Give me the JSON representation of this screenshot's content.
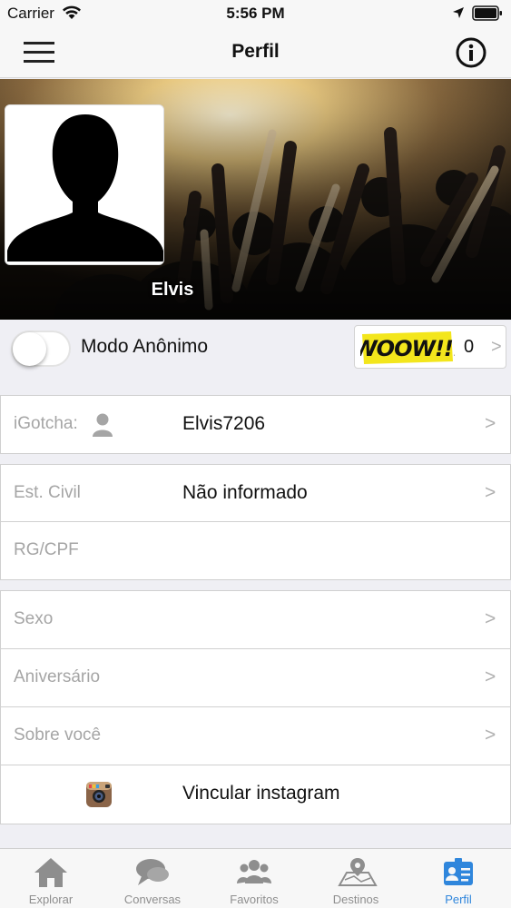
{
  "status_bar": {
    "carrier": "Carrier",
    "time": "5:56 PM"
  },
  "nav": {
    "title": "Perfil"
  },
  "banner": {
    "name": "Elvis"
  },
  "anon": {
    "label": "Modo Anônimo",
    "woow_logo_text": "WOOW!!!",
    "woow_count": "0"
  },
  "rows": {
    "igotcha": {
      "label": "iGotcha:",
      "value": "Elvis7206"
    },
    "civil": {
      "label": "Est. Civil",
      "value": "Não informado"
    },
    "rg": {
      "label": "RG/CPF"
    },
    "sexo": {
      "label": "Sexo"
    },
    "aniversario": {
      "label": "Aniversário"
    },
    "sobre": {
      "label": "Sobre você"
    },
    "instagram": {
      "label": "Vincular instagram"
    }
  },
  "tabs": [
    {
      "label": "Explorar",
      "icon": "home-icon"
    },
    {
      "label": "Conversas",
      "icon": "chat-icon"
    },
    {
      "label": "Favoritos",
      "icon": "group-icon"
    },
    {
      "label": "Destinos",
      "icon": "map-icon"
    },
    {
      "label": "Perfil",
      "icon": "profile-card-icon",
      "active": true
    }
  ],
  "colors": {
    "accent": "#2f86dc",
    "woow_yellow": "#f3e61c",
    "chevron": "#b0b0b0"
  }
}
